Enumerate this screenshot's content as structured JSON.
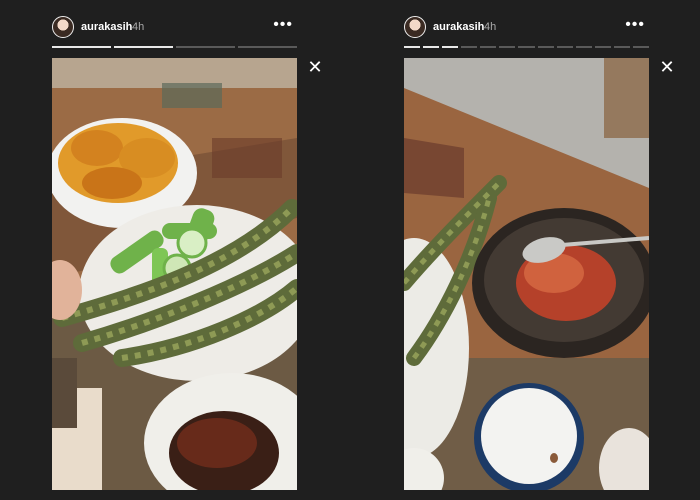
{
  "stories": [
    {
      "username": "aurakasih",
      "time": "4h",
      "more_icon": "more-horizontal-icon",
      "close_icon": "close-icon",
      "segments": {
        "total": 4,
        "viewed": 2
      }
    },
    {
      "username": "aurakasih",
      "time": "4h",
      "more_icon": "more-horizontal-icon",
      "close_icon": "close-icon",
      "segments": {
        "total": 13,
        "viewed": 3
      }
    }
  ]
}
